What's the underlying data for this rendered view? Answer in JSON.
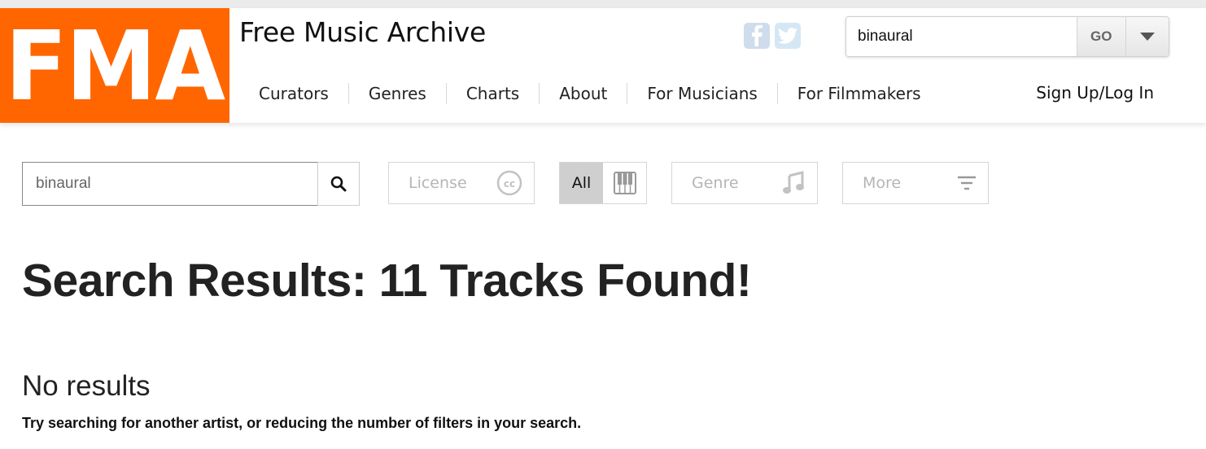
{
  "header": {
    "logo_text": "FMA",
    "site_title": "Free Music Archive",
    "social": {
      "facebook_icon": "facebook-icon",
      "twitter_icon": "twitter-icon"
    },
    "search": {
      "value": "binaural",
      "go_label": "GO",
      "dropdown_icon": "caret-down-icon"
    },
    "nav": [
      "Curators",
      "Genres",
      "Charts",
      "About",
      "For Musicians",
      "For Filmmakers"
    ],
    "signup_label": "Sign Up/Log In"
  },
  "filters": {
    "search_value": "binaural",
    "search_icon": "magnifier-icon",
    "license_label": "License",
    "license_icon": "cc-icon",
    "all_label": "All",
    "piano_icon": "piano-icon",
    "genre_label": "Genre",
    "genre_icon": "music-note-icon",
    "more_label": "More",
    "more_icon": "filter-lines-icon"
  },
  "results": {
    "heading": "Search Results: 11 Tracks Found!",
    "no_results": "No results",
    "hint": "Try searching for another artist, or reducing the number of filters in your search."
  },
  "colors": {
    "brand": "#ff6600",
    "social": "#cfdcec"
  }
}
